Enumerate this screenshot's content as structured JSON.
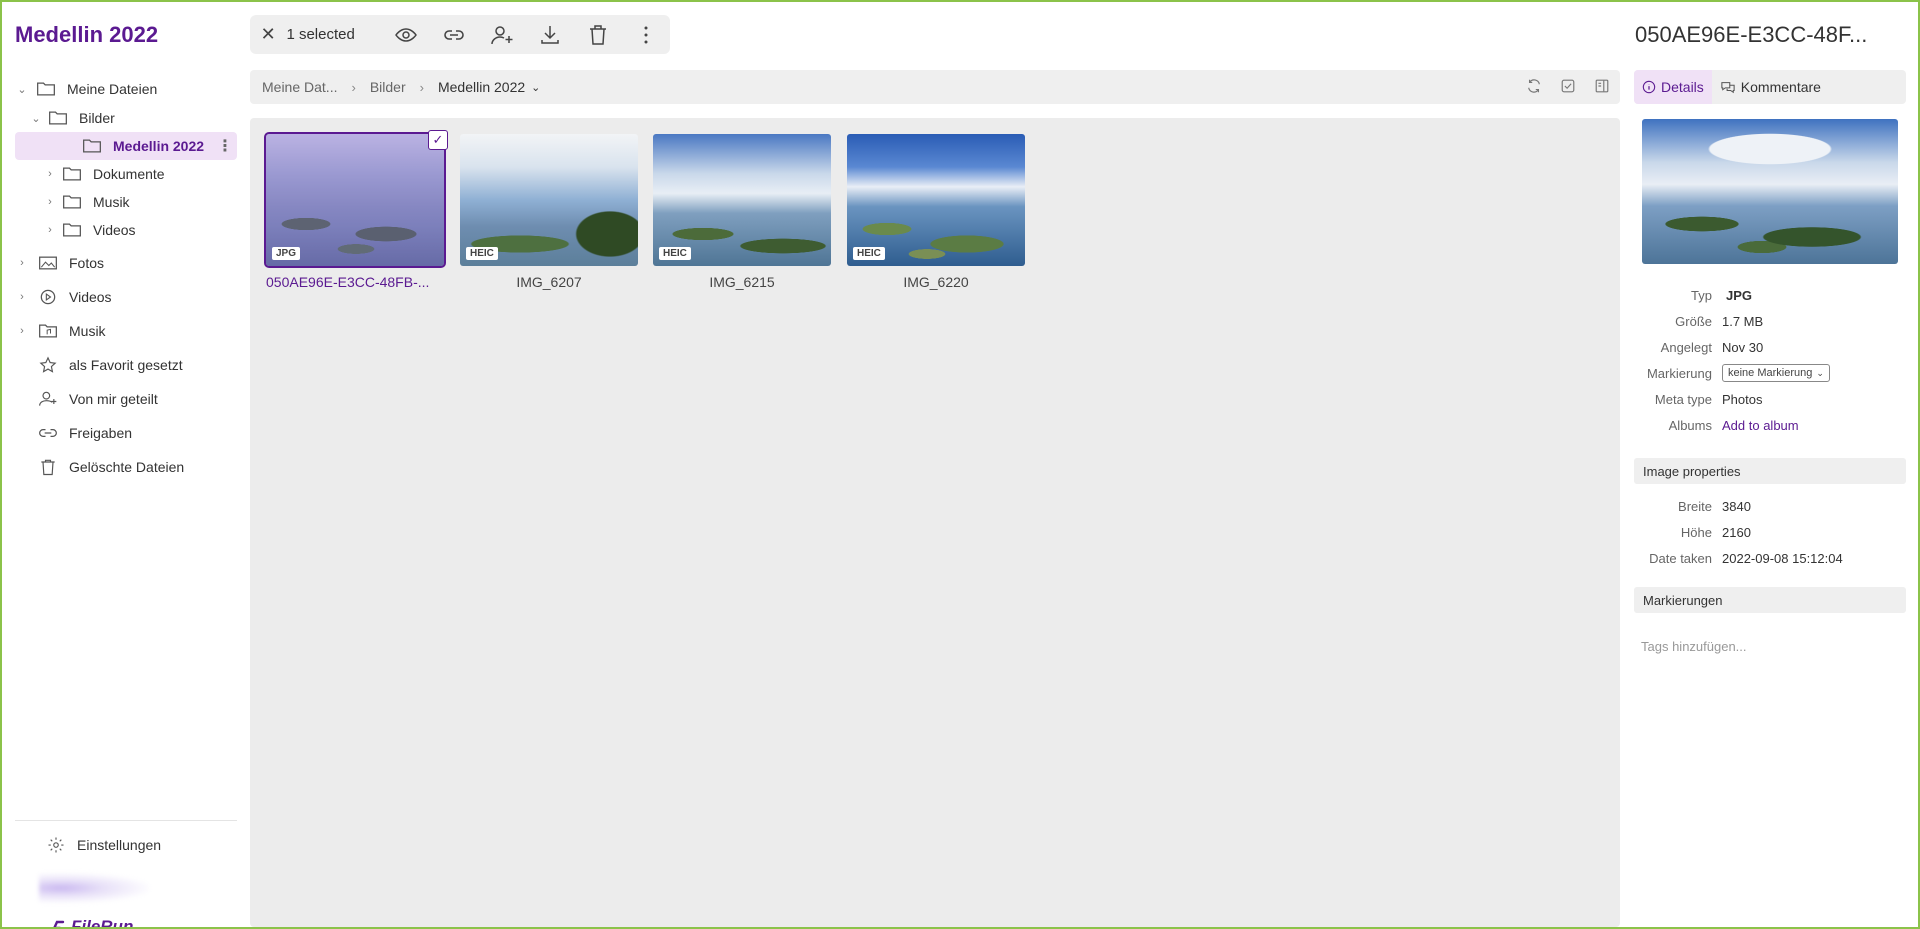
{
  "sidebar": {
    "title": "Medellin 2022",
    "tree": [
      {
        "label": "Meine Dateien",
        "icon": "folder-icon",
        "level": 0,
        "chevron": "down"
      },
      {
        "label": "Bilder",
        "icon": "folder-icon",
        "level": 1,
        "chevron": "down"
      },
      {
        "label": "Medellin 2022",
        "icon": "folder-icon",
        "level": 2,
        "active": true
      },
      {
        "label": "Dokumente",
        "icon": "folder-icon",
        "level": 1,
        "chevron": "right"
      },
      {
        "label": "Musik",
        "icon": "folder-icon",
        "level": 1,
        "chevron": "right"
      },
      {
        "label": "Videos",
        "icon": "folder-icon",
        "level": 1,
        "chevron": "right"
      }
    ],
    "nav": [
      {
        "label": "Fotos",
        "icon": "photos-icon",
        "chevron": "right"
      },
      {
        "label": "Videos",
        "icon": "play-circle-icon",
        "chevron": "right"
      },
      {
        "label": "Musik",
        "icon": "music-folder-icon",
        "chevron": "right"
      },
      {
        "label": "als Favorit gesetzt",
        "icon": "star-icon"
      },
      {
        "label": "Von mir geteilt",
        "icon": "share-user-icon"
      },
      {
        "label": "Freigaben",
        "icon": "link-icon"
      },
      {
        "label": "Gelöschte Dateien",
        "icon": "trash-icon"
      }
    ],
    "settings_label": "Einstellungen",
    "logo_text": "FileRun"
  },
  "toolbar": {
    "selected_label": "1 selected",
    "actions": [
      "eye-icon",
      "link-icon",
      "add-user-icon",
      "download-icon",
      "trash-icon",
      "more-vertical-icon"
    ]
  },
  "breadcrumb": {
    "items": [
      "Meine Dat...",
      "Bilder",
      "Medellin 2022"
    ]
  },
  "files": [
    {
      "name": "050AE96E-E3CC-48FB-...",
      "type": "JPG",
      "selected": true
    },
    {
      "name": "IMG_6207",
      "type": "HEIC"
    },
    {
      "name": "IMG_6215",
      "type": "HEIC"
    },
    {
      "name": "IMG_6220",
      "type": "HEIC"
    }
  ],
  "details": {
    "title": "050AE96E-E3CC-48F...",
    "tabs": {
      "details": "Details",
      "comments": "Kommentare"
    },
    "props": [
      {
        "k": "Typ",
        "v": "JPG",
        "style": "bold"
      },
      {
        "k": "Größe",
        "v": "1.7 MB"
      },
      {
        "k": "Angelegt",
        "v": "Nov 30"
      },
      {
        "k": "Markierung",
        "v": "keine Markierung",
        "style": "select"
      },
      {
        "k": "Meta type",
        "v": "Photos"
      },
      {
        "k": "Albums",
        "v": "Add to album",
        "style": "link"
      }
    ],
    "image_properties_heading": "Image properties",
    "image_props": [
      {
        "k": "Breite",
        "v": "3840"
      },
      {
        "k": "Höhe",
        "v": "2160"
      },
      {
        "k": "Date taken",
        "v": "2022-09-08 15:12:04"
      }
    ],
    "tags_heading": "Markierungen",
    "tags_placeholder": "Tags hinzufügen..."
  },
  "colors": {
    "accent": "#5b1a91",
    "active_bg": "#f0e1f6",
    "frame": "#8bc34a"
  }
}
